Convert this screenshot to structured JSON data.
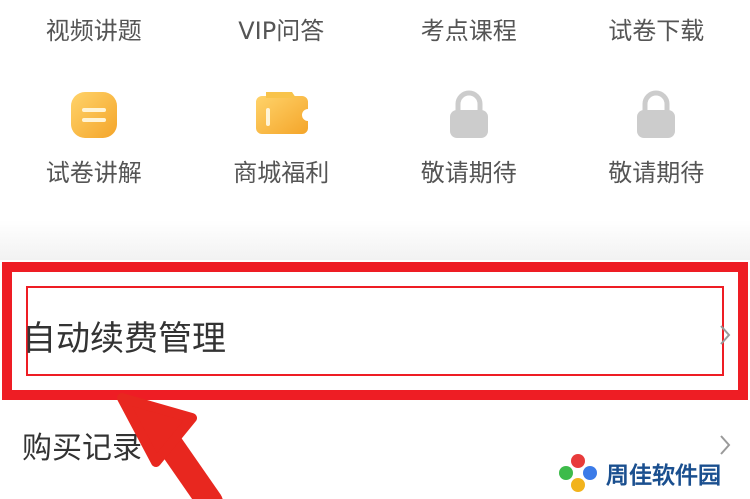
{
  "grid_top": {
    "items": [
      {
        "label": "视频讲题"
      },
      {
        "label": "VIP问答"
      },
      {
        "label": "考点课程"
      },
      {
        "label": "试卷下载"
      }
    ]
  },
  "grid_bottom": {
    "items": [
      {
        "label": "试卷讲解",
        "icon": "document-icon"
      },
      {
        "label": "商城福利",
        "icon": "coupon-icon"
      },
      {
        "label": "敬请期待",
        "icon": "lock-icon"
      },
      {
        "label": "敬请期待",
        "icon": "lock-icon"
      }
    ]
  },
  "menu": {
    "auto_renew_label": "自动续费管理",
    "purchase_history_label": "购买记录"
  },
  "watermark": {
    "text": "周佳软件园"
  },
  "colors": {
    "highlight": "#ee1d24",
    "accent_orange": "#f7b733",
    "lock_gray": "#c8c8c8",
    "watermark_text": "#1a4f8f"
  }
}
